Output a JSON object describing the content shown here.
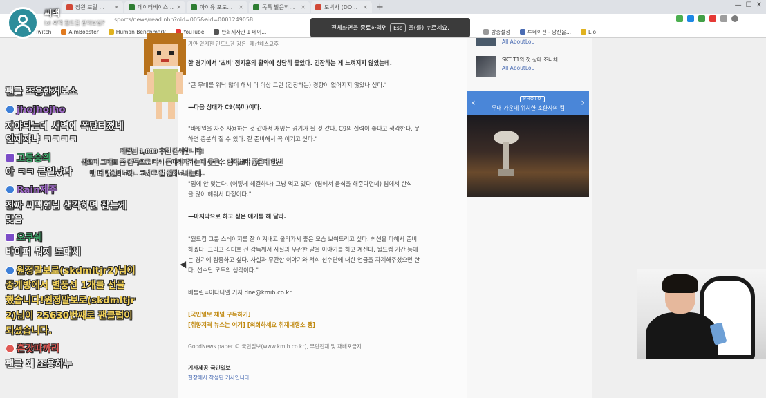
{
  "browser": {
    "tabs": [
      {
        "label": "창원 로컬 ...",
        "color": "#d14836"
      },
      {
        "label": "데이터베이스코리아 검색",
        "color": "#2e7d32"
      },
      {
        "label": "아이유 포토폴 방문",
        "color": "#2e7d32"
      },
      {
        "label": "독특 발음학습기...",
        "color": "#2e7d32"
      },
      {
        "label": "도박사 (DOTAX) - Daum 카페",
        "color": "#d14836"
      }
    ],
    "new_tab": "+",
    "url": "sports/news/read.nhn?oid=005&aid=0001249058",
    "window_controls": [
      "—",
      "☐",
      "✕"
    ],
    "bookmarks": [
      {
        "label": "Twitch",
        "color": "#7b4dc7"
      },
      {
        "label": "AimBooster",
        "color": "#e07a1f"
      },
      {
        "label": "Human Benchmark",
        "color": "#e0b21f"
      },
      {
        "label": "YouTube",
        "color": "#e53935"
      },
      {
        "label": "만화제사관 1 페이...",
        "color": "#555555"
      },
      {
        "label": "방송설정",
        "color": "#999999"
      },
      {
        "label": "투네이션 - 당신을...",
        "color": "#4a6cb3"
      },
      {
        "label": "L.o",
        "color": "#e0b21f"
      }
    ]
  },
  "fullscreen_notice": {
    "before": "전체화면을 종료하려면",
    "key": "Esc",
    "after": "을(를) 누르세요."
  },
  "song": {
    "title": "씨맥",
    "subtitle": "lol 씨맥 월드컵 같이보실?"
  },
  "chat": [
    {
      "type": "msg",
      "text": "팬클 조용한거보소"
    },
    {
      "type": "user",
      "text": "jhojhojho",
      "badge": "blue",
      "color": "purple"
    },
    {
      "type": "msg",
      "text": "자야되는데 새벽에 폭탄터졌네"
    },
    {
      "type": "msg",
      "text": "인제자냐 ㅋㅋㅋㅋ"
    },
    {
      "type": "user",
      "text": "고등승의",
      "badge": "twitch",
      "color": "green"
    },
    {
      "type": "msg",
      "text": "아 ㅋㅋ 큰일났다"
    },
    {
      "type": "user",
      "text": "Rain제주",
      "badge": "blue",
      "color": "purple"
    },
    {
      "type": "msg",
      "text": "진짜 씨맥형님 생각하면 찹는게"
    },
    {
      "type": "msg",
      "text": "맞음"
    },
    {
      "type": "user",
      "text": "오쿠쉐",
      "badge": "twitch",
      "color": "green"
    },
    {
      "type": "msg",
      "text": "바이퍼 뭐지 도대체"
    },
    {
      "type": "gold",
      "text": "원정말보로(skdmltjr2)님이",
      "badge": "blue"
    },
    {
      "type": "gold",
      "text": "종계방에서 별풍선 1개를 선물"
    },
    {
      "type": "gold",
      "text": "했습니다!원정말보로(skdmltjr"
    },
    {
      "type": "gold",
      "text": "2)님이 25630번째로 팬클럽이"
    },
    {
      "type": "gold",
      "text": "되셨습니다."
    },
    {
      "type": "user",
      "text": "흔갓따까리",
      "badge": "fire",
      "color": "red"
    },
    {
      "type": "msg",
      "text": "팬클 왜 조용하누"
    }
  ],
  "overlay_notes": [
    "대령님 1,000 후원 감사합니다!",
    "귀요미 그래도 좀 감독으로 다시 돌아가야하는데 웃을수 생각보다 좋은데 한번",
    "민 더 망설이보자.. 코치로 잘 설해보시는데.."
  ],
  "article": {
    "lines": [
      {
        "text": "기안 있게진 인드느겐 강은: 제선해스교후",
        "style": "normal"
      },
      {
        "text": "한 경기에서 '초비' 정지훈의 활약에 상당히 좋았다. 긴장하는 게 느껴지지 않았는데.",
        "style": "bold"
      },
      {
        "text": "\"큰 무대를 워낙 많이 해서 더 이상 그런 (긴장하는) 경향이 없어지지 않았나 싶다.\"",
        "style": "normal"
      },
      {
        "text": "—다음 상대가 C9(북미)이다.",
        "style": "bold"
      },
      {
        "text": "\"바윗일을 자주 사용하는 것 같아서 재밌는 경기가 될 것 같다. C9의 실력이 좋다고 생각한다. 못",
        "style": "normal"
      },
      {
        "text": "하면 충분히 질 수 있다. 잘 준비해서 꼭 이기고 싶다.\"",
        "style": "normal"
      },
      {
        "text": "\"입에 안 맞는다. (어떻게 해결하나) 그냥 먹고 있다. (팀에서 음식을 해준다던데) 팀에서 한식",
        "style": "normal"
      },
      {
        "text": "을 많이 해줘서 다행이다.\"",
        "style": "normal"
      },
      {
        "text": "—마지막으로 하고 싶은 얘기를 해 달라.",
        "style": "bold"
      },
      {
        "text": "\"월드컵 그룹 스테이지를 잘 이겨내고 올라가서 좋은 모습 보여드리고 싶다. 최선을 다해서 준비",
        "style": "normal"
      },
      {
        "text": "하겠다. 그리고 김대호 전 감독께서 사실과 무관한 말을 이야기를 하고 계신다. 월드컵 기간 동에",
        "style": "normal"
      },
      {
        "text": "는 경기에 집중하고 싶다. 사실과 무관한 이야기와 저희 선수단에 대한 언급을 자제해주셨으면 한",
        "style": "normal"
      },
      {
        "text": "다. 선수단 모두의 생각이다.\"",
        "style": "normal"
      },
      {
        "text": "베를린=이다니엘 기자 dne@kmib.co.kr",
        "style": "normal"
      },
      {
        "text": "[국민일보 채널 구독하기]",
        "style": "link"
      },
      {
        "text": "[취향저격 뉴스는 여기] [의회하세요 취재대행소 왱]",
        "style": "link"
      },
      {
        "text": "GoodNews paper © 국민일보(www.kmib.co.kr), 무단전재 및 재배포금지",
        "style": "normal"
      },
      {
        "text": "기사제공   국민일보",
        "style": "bold"
      },
      {
        "text": "한장에서 작성된 기사입니다.",
        "style": "blue"
      }
    ]
  },
  "sidebar": {
    "items": [
      {
        "title": "",
        "sub": "All AboutLoL"
      },
      {
        "title": "SKT T1의 첫 상대 조나체",
        "sub": "All AboutLoL"
      }
    ],
    "photo_tag": "PHOTO",
    "photo_caption": "무대 가운데 위치한 소환사의 컵",
    "prev": "‹",
    "next": "›"
  }
}
